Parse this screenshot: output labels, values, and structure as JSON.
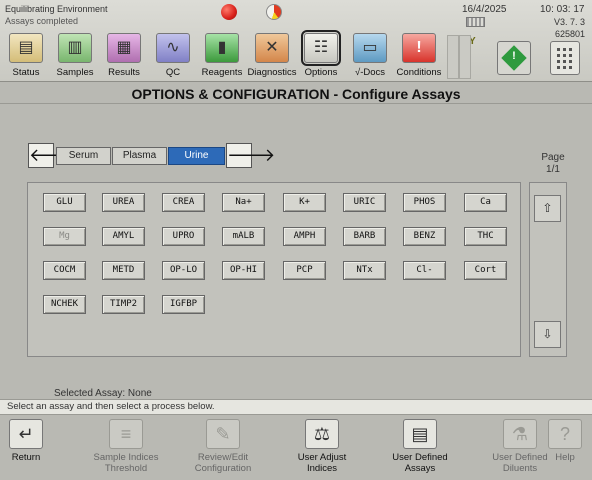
{
  "status": {
    "line1": "Equilibrating Environment",
    "line2": "Assays completed"
  },
  "system": {
    "date": "16/4/2025",
    "time": "10: 03: 17",
    "version": "V3. 7. 3",
    "serial": "625801"
  },
  "toolbar": [
    {
      "label": "Status",
      "icon": "status-icon",
      "glyph": "▤"
    },
    {
      "label": "Samples",
      "icon": "samples-icon",
      "glyph": "▥"
    },
    {
      "label": "Results",
      "icon": "results-icon",
      "glyph": "▦"
    },
    {
      "label": "QC",
      "icon": "qc-icon",
      "glyph": "∿"
    },
    {
      "label": "Reagents",
      "icon": "reagents-icon",
      "glyph": "▮"
    },
    {
      "label": "Diagnostics",
      "icon": "diagnostics-icon",
      "glyph": "✕"
    },
    {
      "label": "Options",
      "icon": "options-icon",
      "glyph": "☷"
    },
    {
      "label": "√-Docs",
      "icon": "docs-icon",
      "glyph": "▭"
    },
    {
      "label": "Conditions",
      "icon": "conditions-icon",
      "glyph": "!"
    }
  ],
  "page": {
    "title": "OPTIONS & CONFIGURATION - Configure Assays"
  },
  "sample_types": {
    "serum": "Serum",
    "plasma": "Plasma",
    "urine": "Urine",
    "selected": "Urine"
  },
  "pager": {
    "label": "Page",
    "value": "1/1"
  },
  "assays": [
    [
      "GLU",
      "UREA",
      "CREA",
      "Na+",
      "K+",
      "URIC",
      "PHOS",
      "Ca"
    ],
    [
      "Mg",
      "AMYL",
      "UPRO",
      "mALB",
      "AMPH",
      "BARB",
      "BENZ",
      "THC"
    ],
    [
      "COCM",
      "METD",
      "OP-LO",
      "OP-HI",
      "PCP",
      "NTx",
      "Cl-",
      "Cort"
    ],
    [
      "NCHEK",
      "TIMP2",
      "IGFBP"
    ]
  ],
  "dimmed_assays": [
    "Mg"
  ],
  "selection": {
    "selected_assay_text": "Selected Assay: None",
    "hint": "Select an assay and then select a process below."
  },
  "footer": [
    {
      "label": "Return",
      "icon": "return-icon",
      "glyph": "↵",
      "enabled": true
    },
    {
      "label": "Sample Indices\nThreshold",
      "icon": "sample-indices-icon",
      "glyph": "≡",
      "enabled": false
    },
    {
      "label": "Review/Edit\nConfiguration",
      "icon": "review-edit-icon",
      "glyph": "✎",
      "enabled": false
    },
    {
      "label": "User Adjust\nIndices",
      "icon": "user-adjust-icon",
      "glyph": "⚖",
      "enabled": true
    },
    {
      "label": "User Defined\nAssays",
      "icon": "user-defined-assays-icon",
      "glyph": "▤",
      "enabled": true
    },
    {
      "label": "User Defined\nDiluents",
      "icon": "user-defined-diluents-icon",
      "glyph": "⚗",
      "enabled": false
    },
    {
      "label": "Help",
      "icon": "help-icon",
      "glyph": "?",
      "enabled": false
    }
  ],
  "colors": {
    "selected_tab": "#2d6ab8",
    "status_led": "#d8201a",
    "go_button": "#2e9a3e"
  }
}
